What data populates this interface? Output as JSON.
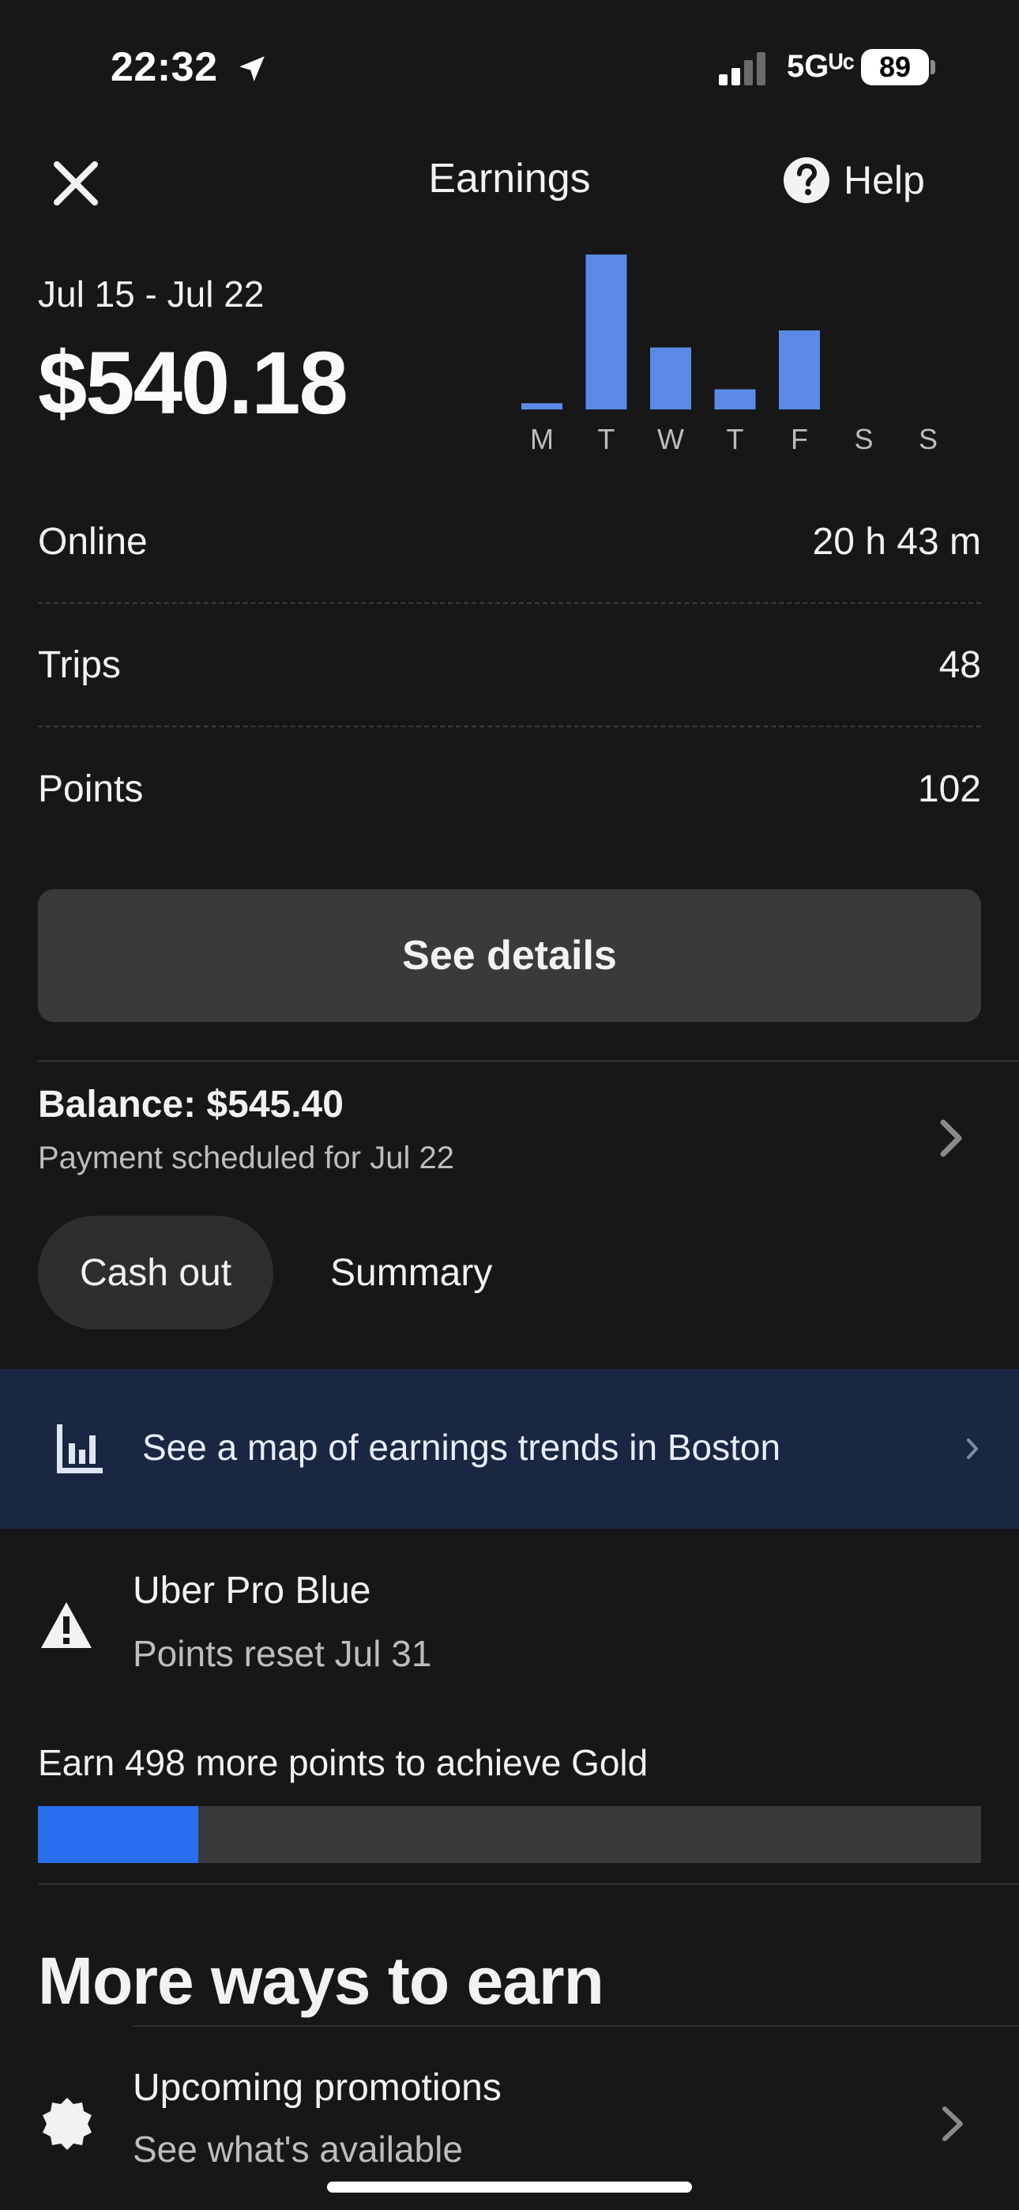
{
  "status_bar": {
    "time": "22:32",
    "network": "5Gᵁᶜ",
    "battery": "89"
  },
  "header": {
    "title": "Earnings",
    "help_label": "Help"
  },
  "summary": {
    "date_range": "Jul 15 - Jul 22",
    "total": "$540.18"
  },
  "chart_data": {
    "type": "bar",
    "categories": [
      "M",
      "T",
      "W",
      "T",
      "F",
      "S",
      "S"
    ],
    "values": [
      4,
      100,
      40,
      13,
      51,
      0,
      0
    ],
    "ylim": [
      0,
      100
    ],
    "bar_color": "#5a8ae6",
    "label_color": "#bdbdbd"
  },
  "stats": [
    {
      "label": "Online",
      "value": "20 h 43 m"
    },
    {
      "label": "Trips",
      "value": "48"
    },
    {
      "label": "Points",
      "value": "102"
    }
  ],
  "see_details_label": "See details",
  "balance": {
    "title": "Balance: $545.40",
    "subtitle": "Payment scheduled for Jul 22"
  },
  "actions": {
    "cash_out": "Cash out",
    "summary": "Summary"
  },
  "trends_banner": {
    "label": "See a map of earnings trends in Boston",
    "icon": "bar-chart-icon"
  },
  "uber_pro": {
    "title": "Uber Pro Blue",
    "subtitle": "Points reset Jul 31",
    "goal_label": "Earn 498 more points to achieve Gold",
    "progress_fraction": 0.17,
    "progress_color": "#276ef1"
  },
  "more_ways": {
    "title": "More ways to earn",
    "items": [
      {
        "title": "Upcoming promotions",
        "subtitle": "See what's available",
        "icon": "promotion-badge-icon"
      }
    ]
  }
}
